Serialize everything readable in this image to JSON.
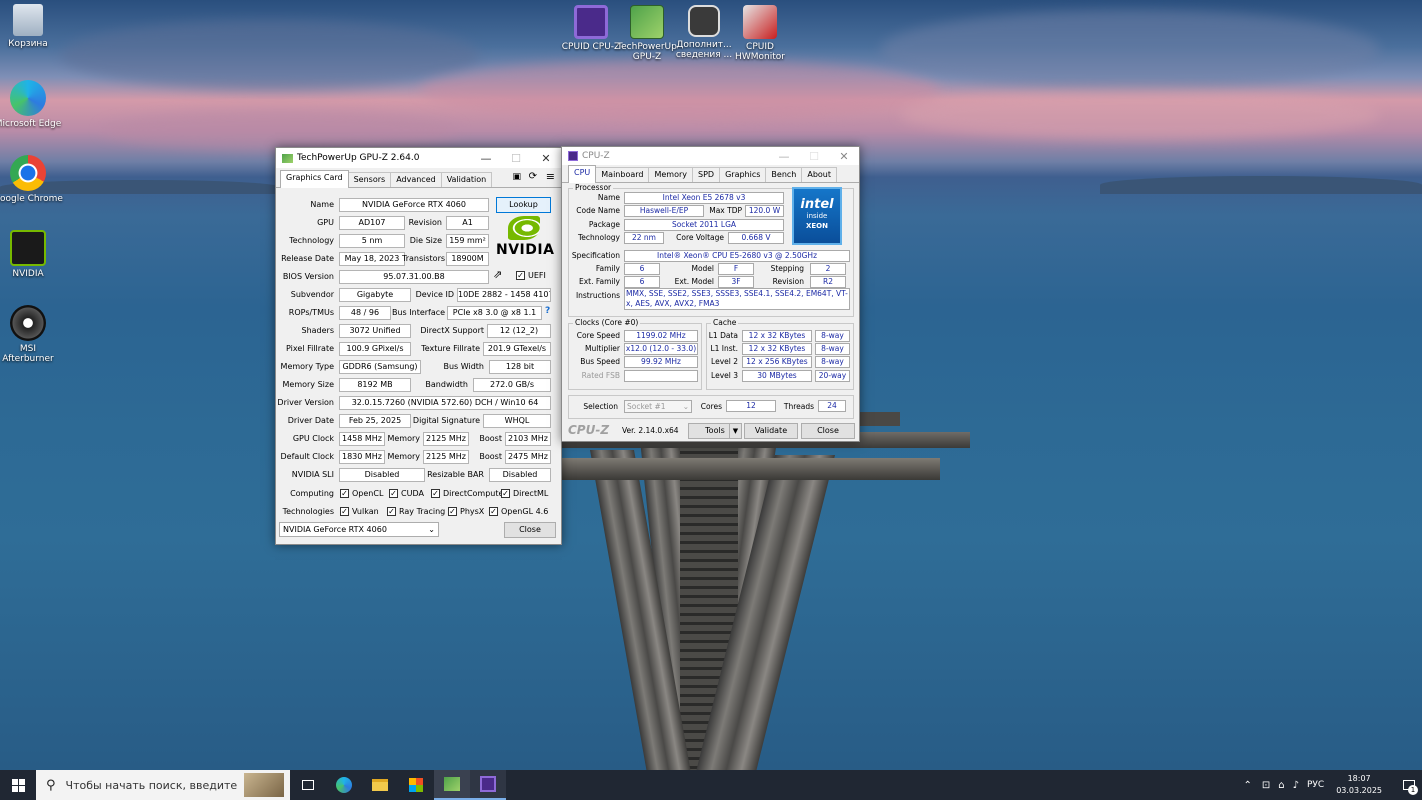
{
  "desktop": {
    "icons_left": [
      {
        "label": "Корзина",
        "icon": "recycle-bin-icon"
      },
      {
        "label": "Microsoft Edge",
        "icon": "edge-icon"
      },
      {
        "label": "Google Chrome",
        "icon": "chrome-icon"
      },
      {
        "label": "NVIDIA",
        "icon": "nvidia-icon"
      },
      {
        "label": "MSI Afterburner",
        "icon": "msi-afterburner-icon"
      }
    ],
    "icons_top": [
      {
        "label": "CPUID CPU-Z",
        "icon": "cpuz-icon"
      },
      {
        "label": "TechPowerUp GPU-Z",
        "icon": "gpuz-icon"
      },
      {
        "label": "Дополнит... сведения ...",
        "icon": "info-icon"
      },
      {
        "label": "CPUID HWMonitor",
        "icon": "hwmonitor-icon"
      }
    ]
  },
  "gpuz": {
    "title": "TechPowerUp GPU-Z 2.64.0",
    "tabs": [
      "Graphics Card",
      "Sensors",
      "Advanced",
      "Validation"
    ],
    "lookup": "Lookup",
    "uefi": "UEFI",
    "logo": "NVIDIA",
    "name_label": "Name",
    "name": "NVIDIA GeForce RTX 4060",
    "gpu_label": "GPU",
    "gpu": "AD107",
    "revision_label": "Revision",
    "revision": "A1",
    "technology_label": "Technology",
    "technology": "5 nm",
    "diesize_label": "Die Size",
    "diesize": "159 mm²",
    "release_label": "Release Date",
    "release": "May 18, 2023",
    "transistors_label": "Transistors",
    "transistors": "18900M",
    "bios_label": "BIOS Version",
    "bios": "95.07.31.00.B8",
    "subvendor_label": "Subvendor",
    "subvendor": "Gigabyte",
    "deviceid_label": "Device ID",
    "deviceid": "10DE 2882 - 1458 4107",
    "rops_label": "ROPs/TMUs",
    "rops": "48 / 96",
    "busif_label": "Bus Interface",
    "busif": "PCIe x8 3.0 @ x8 1.1",
    "shaders_label": "Shaders",
    "shaders": "3072 Unified",
    "dx_label": "DirectX Support",
    "dx": "12 (12_2)",
    "pixel_label": "Pixel Fillrate",
    "pixel": "100.9 GPixel/s",
    "texture_label": "Texture Fillrate",
    "texture": "201.9 GTexel/s",
    "memtype_label": "Memory Type",
    "memtype": "GDDR6 (Samsung)",
    "buswidth_label": "Bus Width",
    "buswidth": "128 bit",
    "memsize_label": "Memory Size",
    "memsize": "8192 MB",
    "bandwidth_label": "Bandwidth",
    "bandwidth": "272.0 GB/s",
    "driverver_label": "Driver Version",
    "driverver": "32.0.15.7260 (NVIDIA 572.60) DCH / Win10 64",
    "driverdate_label": "Driver Date",
    "driverdate": "Feb 25, 2025",
    "sig_label": "Digital Signature",
    "sig": "WHQL",
    "gpuclock_label": "GPU Clock",
    "gpuclock": "1458 MHz",
    "memory_label": "Memory",
    "memclock": "2125 MHz",
    "boost_label": "Boost",
    "boost": "2103 MHz",
    "defclock_label": "Default Clock",
    "defclock": "1830 MHz",
    "defmem": "2125 MHz",
    "defboost": "2475 MHz",
    "sli_label": "NVIDIA SLI",
    "sli": "Disabled",
    "rebar_label": "Resizable BAR",
    "rebar": "Disabled",
    "computing_label": "Computing",
    "computing": [
      "OpenCL",
      "CUDA",
      "DirectCompute",
      "DirectML"
    ],
    "technologies_label": "Technologies",
    "technologies": [
      "Vulkan",
      "Ray Tracing",
      "PhysX",
      "OpenGL 4.6"
    ],
    "select": "NVIDIA GeForce RTX 4060",
    "close": "Close"
  },
  "cpuz": {
    "title": "CPU-Z",
    "tabs": [
      "CPU",
      "Mainboard",
      "Memory",
      "SPD",
      "Graphics",
      "Bench",
      "About"
    ],
    "processor_group": "Processor",
    "name_label": "Name",
    "name": "Intel Xeon E5 2678 v3",
    "codename_label": "Code Name",
    "codename": "Haswell-E/EP",
    "maxtdp_label": "Max TDP",
    "maxtdp": "120.0 W",
    "package_label": "Package",
    "package": "Socket 2011 LGA",
    "technology_label": "Technology",
    "technology": "22 nm",
    "corevolt_label": "Core Voltage",
    "corevolt": "0.668 V",
    "spec_label": "Specification",
    "spec": "Intel® Xeon® CPU E5-2680 v3 @ 2.50GHz",
    "family_label": "Family",
    "family": "6",
    "model_label": "Model",
    "model": "F",
    "stepping_label": "Stepping",
    "stepping": "2",
    "extfamily_label": "Ext. Family",
    "extfamily": "6",
    "extmodel_label": "Ext. Model",
    "extmodel": "3F",
    "revision_label": "Revision",
    "revision": "R2",
    "instr_label": "Instructions",
    "instr": "MMX, SSE, SSE2, SSE3, SSSE3, SSE4.1, SSE4.2, EM64T, VT-x, AES, AVX, AVX2, FMA3",
    "clocks_group": "Clocks (Core #0)",
    "corespeed_label": "Core Speed",
    "corespeed": "1199.02 MHz",
    "multiplier_label": "Multiplier",
    "multiplier": "x12.0 (12.0 - 33.0)",
    "busspeed_label": "Bus Speed",
    "busspeed": "99.92 MHz",
    "ratedfsb_label": "Rated FSB",
    "ratedfsb": "",
    "cache_group": "Cache",
    "l1d_label": "L1 Data",
    "l1d": "12 x 32 KBytes",
    "l1d_way": "8-way",
    "l1i_label": "L1 Inst.",
    "l1i": "12 x 32 KBytes",
    "l1i_way": "8-way",
    "l2_label": "Level 2",
    "l2": "12 x 256 KBytes",
    "l2_way": "8-way",
    "l3_label": "Level 3",
    "l3": "30 MBytes",
    "l3_way": "20-way",
    "selection_label": "Selection",
    "selection": "Socket #1",
    "cores_label": "Cores",
    "cores": "12",
    "threads_label": "Threads",
    "threads": "24",
    "brand": "CPU-Z",
    "version": "Ver. 2.14.0.x64",
    "tools": "Tools",
    "validate": "Validate",
    "close": "Close",
    "logo_line1": "intel",
    "logo_line2": "inside",
    "logo_line3": "XEON"
  },
  "taskbar": {
    "search_placeholder": "Чтобы начать поиск, введите",
    "lang": "РУС",
    "time": "18:07",
    "date": "03.03.2025",
    "notif_count": "1"
  }
}
